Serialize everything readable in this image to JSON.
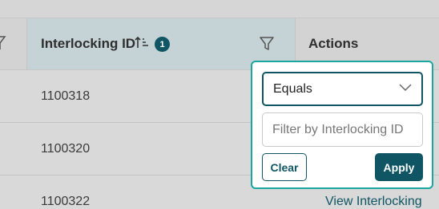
{
  "table": {
    "columns": [
      {
        "label": "Interlocking ID",
        "active_filter_count": "1"
      },
      {
        "label": "Actions"
      }
    ],
    "rows": [
      {
        "id": "1100318",
        "action": ""
      },
      {
        "id": "1100320",
        "action": ""
      },
      {
        "id": "1100322",
        "action": "View Interlocking"
      }
    ],
    "icons": {
      "sort": "sort-ascending-icon",
      "filter": "filter-funnel-icon"
    }
  },
  "filter_popup": {
    "operator": {
      "selected": "Equals",
      "icon": "chevron-down-icon"
    },
    "input": {
      "value": "",
      "placeholder": "Filter by Interlocking ID"
    },
    "clear_label": "Clear",
    "apply_label": "Apply"
  },
  "colors": {
    "accent": "#0f5563",
    "popup_border": "#1aa7a0",
    "active_header": "#c5d2d6"
  }
}
